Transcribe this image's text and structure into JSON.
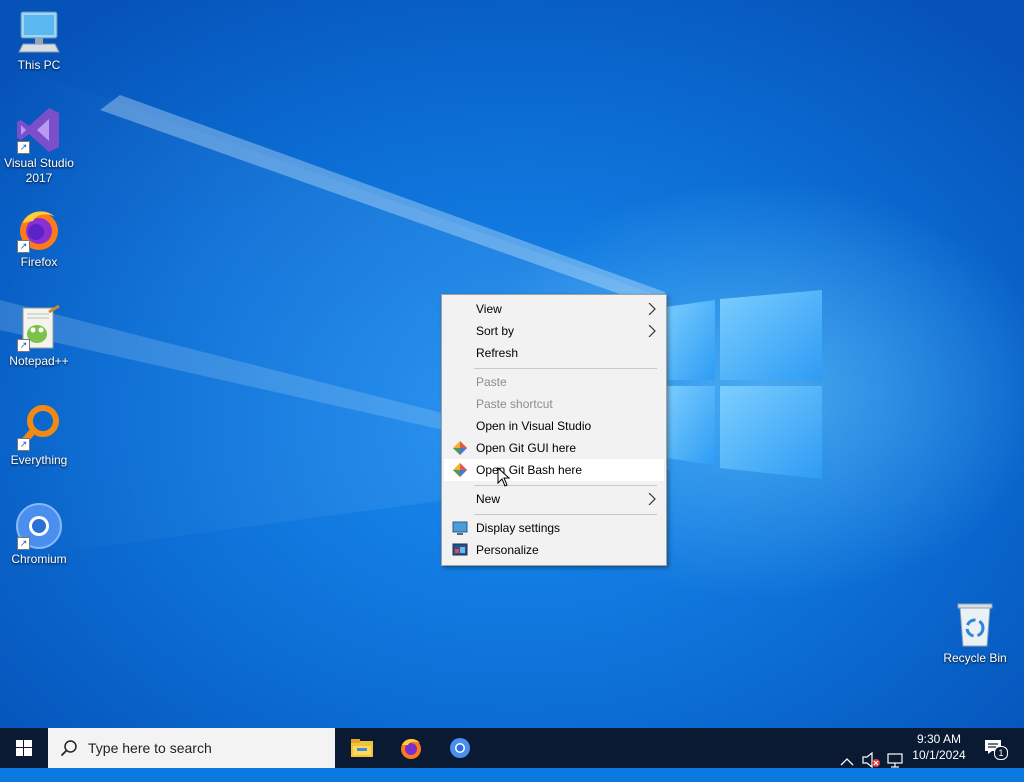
{
  "desktop": {
    "icons": [
      {
        "label_line1": "This PC",
        "label_line2": ""
      },
      {
        "label_line1": "Visual Studio",
        "label_line2": "2017"
      },
      {
        "label_line1": "Firefox",
        "label_line2": ""
      },
      {
        "label_line1": "Notepad++",
        "label_line2": ""
      },
      {
        "label_line1": "Everything",
        "label_line2": ""
      },
      {
        "label_line1": "Chromium",
        "label_line2": ""
      }
    ],
    "recycle_bin": "Recycle Bin"
  },
  "context_menu": {
    "items": [
      {
        "label": "View",
        "submenu": true,
        "enabled": true
      },
      {
        "label": "Sort by",
        "submenu": true,
        "enabled": true
      },
      {
        "label": "Refresh",
        "enabled": true
      },
      {
        "label": "Paste",
        "enabled": false
      },
      {
        "label": "Paste shortcut",
        "enabled": false
      },
      {
        "label": "Open in Visual Studio",
        "enabled": true
      },
      {
        "label": "Open Git GUI here",
        "enabled": true,
        "icon": "git-icon"
      },
      {
        "label": "Open Git Bash here",
        "enabled": true,
        "icon": "git-icon",
        "highlighted": true
      },
      {
        "label": "New",
        "submenu": true,
        "enabled": true
      },
      {
        "label": "Display settings",
        "enabled": true,
        "icon": "display-icon"
      },
      {
        "label": "Personalize",
        "enabled": true,
        "icon": "personalize-icon"
      }
    ]
  },
  "taskbar": {
    "search_placeholder": "Type here to search",
    "apps": [
      "file-explorer-icon",
      "firefox-icon",
      "chromium-icon"
    ],
    "clock": {
      "time": "9:30 AM",
      "date": "10/1/2024"
    },
    "notification_count": "1"
  },
  "colors": {
    "wallpaper": "#0c6fd6",
    "taskbar": "#0a1a33",
    "menu_bg": "#f2f2f2",
    "menu_disabled_text": "#8d8d8d"
  }
}
